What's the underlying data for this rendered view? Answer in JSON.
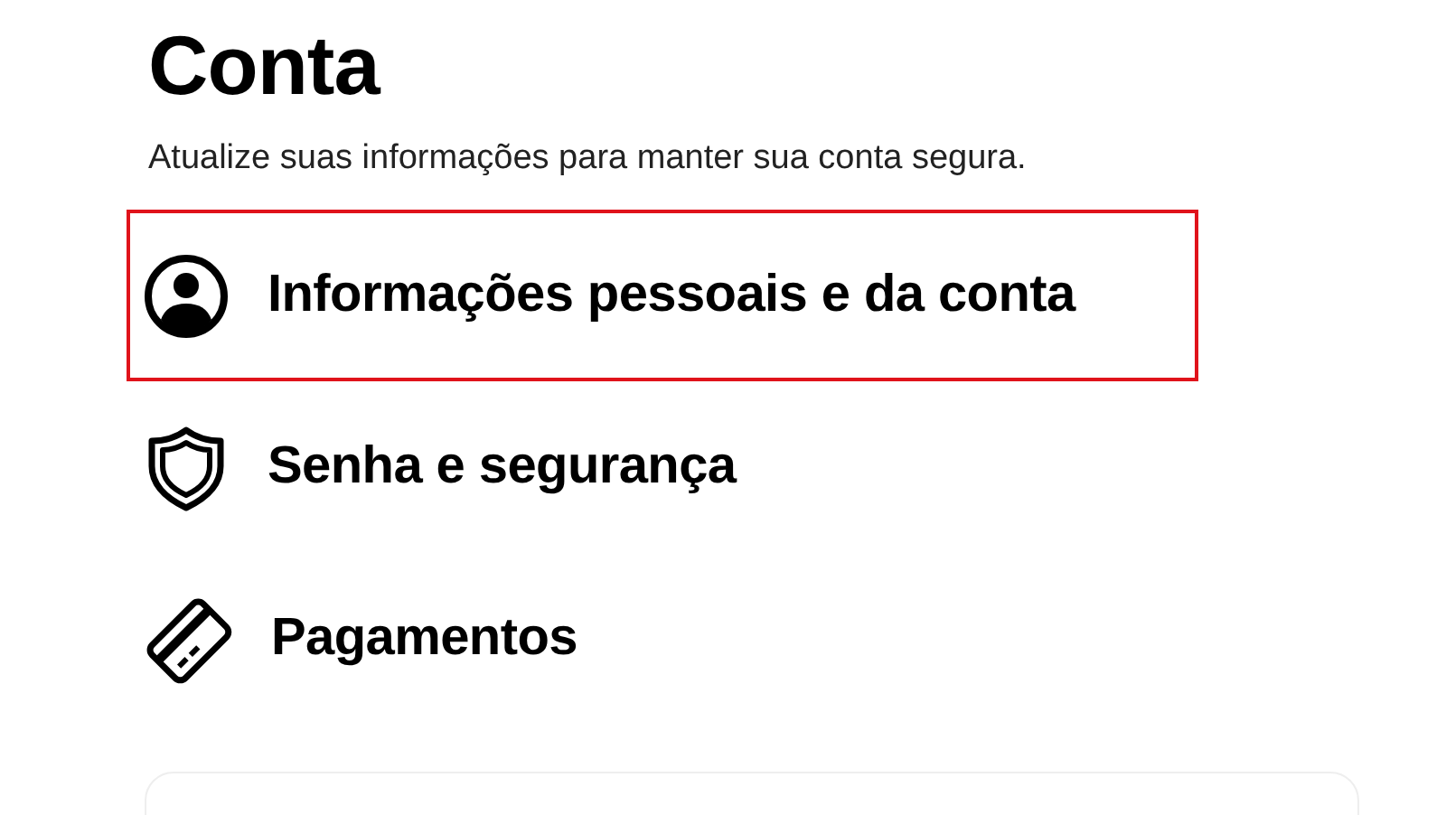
{
  "title": "Conta",
  "subtitle": "Atualize suas informações para manter sua conta segura.",
  "items": [
    {
      "kind": "person",
      "label": "Informações pessoais e da conta",
      "highlighted": true
    },
    {
      "kind": "shield",
      "label": "Senha e segurança",
      "highlighted": false
    },
    {
      "kind": "card",
      "label": "Pagamentos",
      "highlighted": false
    }
  ]
}
